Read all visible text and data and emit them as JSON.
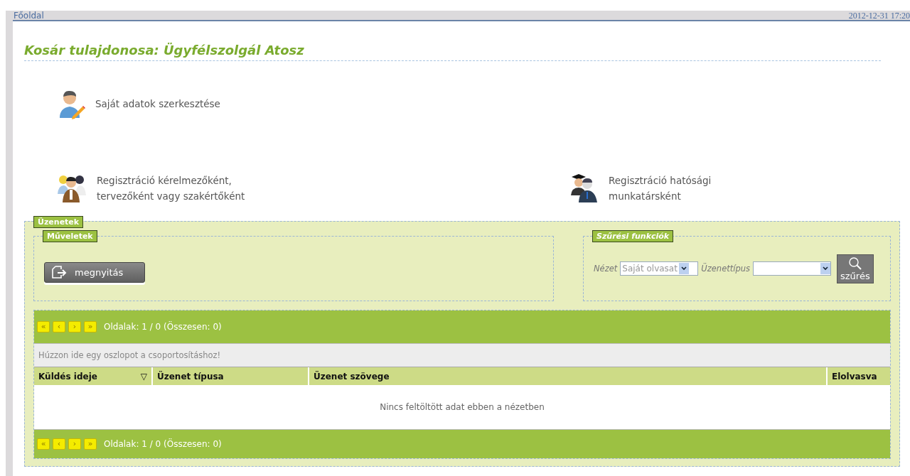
{
  "top_bar": {
    "breadcrumb": "Főoldal",
    "datetime": "2012-12-31 17:20"
  },
  "title": "Kosár tulajdonosa: Ügyfélszolgál Atosz",
  "links": [
    {
      "kind": "edit-user",
      "label": "Saját adatok szerkesztése"
    },
    {
      "kind": "applicant",
      "label": "Regisztráció kérelmezőként,\ntervezőként vagy szakértőként"
    },
    {
      "kind": "official",
      "label": "Regisztráció hatósági\nmunkatársként"
    }
  ],
  "messages": {
    "legend": "Üzenetek",
    "actions": {
      "legend": "Műveletek",
      "buttons": [
        "megnyitás"
      ]
    },
    "filters": {
      "legend": "Szűrési funkciók",
      "view_label": "Nézet",
      "view_value": "Saját olvasat",
      "type_label": "Üzenettípus",
      "button": "szűrés"
    },
    "grid": {
      "pager_buttons": [
        "«",
        "‹",
        "›",
        "»"
      ],
      "pager_text": "Oldalak: 1 / 0 (Összesen: 0)",
      "group_hint": "Húzzon ide egy oszlopot a csoportosításhoz!",
      "columns": [
        {
          "label": "Küldés ideje",
          "filter_icon": "▽"
        },
        {
          "label": "Üzenet típusa"
        },
        {
          "label": "Üzenet szövege"
        },
        {
          "label": "Elolvasva"
        }
      ],
      "empty_text": "Nincs feltöltött adat ebben a nézetben",
      "bottom_pager_buttons": [
        "«",
        "‹",
        "›",
        "»"
      ],
      "bottom_pager_text": "Oldalak: 1 / 0 (Összesen: 0)"
    }
  }
}
